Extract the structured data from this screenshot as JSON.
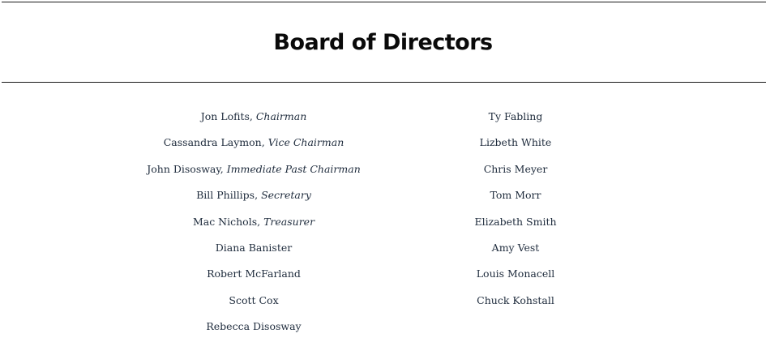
{
  "page": {
    "title": "Board of Directors"
  },
  "board": {
    "left_column": [
      {
        "name": "Jon Lofits",
        "role": "Chairman"
      },
      {
        "name": "Cassandra Laymon",
        "role": "Vice Chairman"
      },
      {
        "name": "John Disosway",
        "role": "Immediate Past Chairman"
      },
      {
        "name": "Bill Phillips",
        "role": "Secretary"
      },
      {
        "name": "Mac Nichols",
        "role": "Treasurer"
      },
      {
        "name": "Diana Banister",
        "role": ""
      },
      {
        "name": "Robert McFarland",
        "role": ""
      },
      {
        "name": "Scott Cox",
        "role": ""
      },
      {
        "name": "Rebecca Disosway",
        "role": ""
      }
    ],
    "right_column": [
      {
        "name": "Ty Fabling"
      },
      {
        "name": "Lizbeth White"
      },
      {
        "name": "Chris Meyer"
      },
      {
        "name": "Tom Morr"
      },
      {
        "name": "Elizabeth Smith"
      },
      {
        "name": "Amy Vest"
      },
      {
        "name": "Louis Monacell"
      },
      {
        "name": "Chuck Kohstall"
      }
    ]
  },
  "colors": {
    "text": "#1e2b3c",
    "title": "#0a0a0a",
    "rule": "#1a1a1a",
    "background": "#ffffff"
  }
}
